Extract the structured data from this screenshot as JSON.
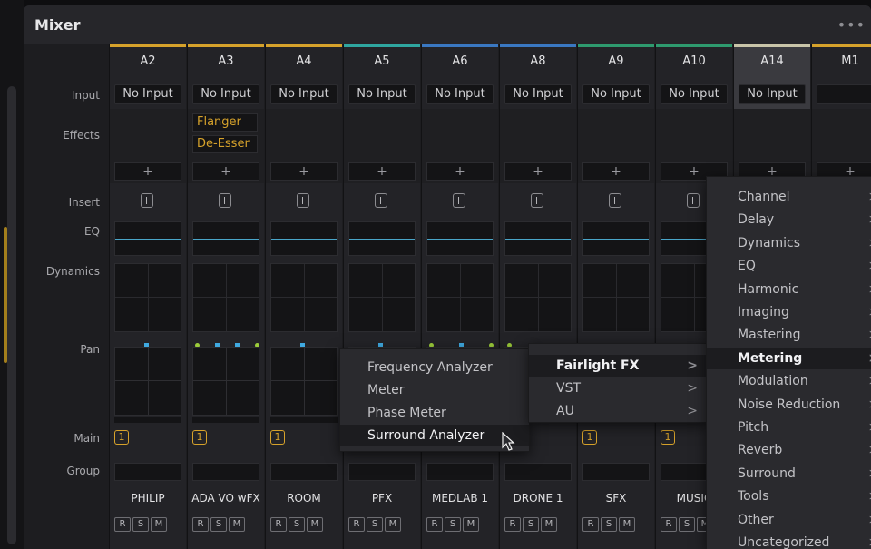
{
  "window": {
    "title": "Mixer",
    "more": "•••"
  },
  "row_labels": [
    "Input",
    "Effects",
    "Insert",
    "EQ",
    "Dynamics",
    "Pan",
    "Main",
    "Group"
  ],
  "strips": [
    {
      "id": "A2",
      "input": "No Input",
      "effects": [],
      "name": "PHILIP",
      "main": "1",
      "color": "#d6a22b",
      "pan_dots": [
        "b"
      ]
    },
    {
      "id": "A3",
      "input": "No Input",
      "effects": [
        "Flanger",
        "De-Esser"
      ],
      "name": "ADA VO wFX",
      "main": "1",
      "color": "#d6a22b",
      "pan_dots": [
        "g",
        "b",
        "b",
        "g"
      ]
    },
    {
      "id": "A4",
      "input": "No Input",
      "effects": [],
      "name": "ROOM",
      "main": "1",
      "color": "#d6a22b",
      "pan_dots": [
        "b"
      ]
    },
    {
      "id": "A5",
      "input": "No Input",
      "effects": [],
      "name": "PFX",
      "main": "",
      "color": "#2fa6a0",
      "pan_dots": [
        "b"
      ]
    },
    {
      "id": "A6",
      "input": "No Input",
      "effects": [],
      "name": "MEDLAB 1",
      "main": "",
      "color": "#3a78c2",
      "pan_dots": [
        "g",
        "b",
        "g"
      ]
    },
    {
      "id": "A8",
      "input": "No Input",
      "effects": [],
      "name": "DRONE 1",
      "main": "",
      "color": "#3a78c2",
      "pan_dots": [
        "g",
        "b",
        "b"
      ]
    },
    {
      "id": "A9",
      "input": "No Input",
      "effects": [],
      "name": "SFX",
      "main": "1",
      "color": "#2e9a6e",
      "pan_dots": []
    },
    {
      "id": "A10",
      "input": "No Input",
      "effects": [],
      "name": "MUSIC",
      "main": "1",
      "color": "#2e9a6e",
      "pan_dots": [
        "b"
      ]
    },
    {
      "id": "A14",
      "input": "No Input",
      "effects": [],
      "name": "",
      "main": "",
      "color": "#c8c4a8",
      "pan_dots": []
    },
    {
      "id": "M1",
      "input": "",
      "effects": [],
      "name": "",
      "main": "",
      "color": "#d6a22b",
      "pan_dots": []
    }
  ],
  "rsm_labels": [
    "R",
    "S",
    "M"
  ],
  "plus_label": "+",
  "menu_plugin_type": {
    "items": [
      {
        "label": "Fairlight FX",
        "arrow": ">"
      },
      {
        "label": "VST",
        "arrow": ">"
      },
      {
        "label": "AU",
        "arrow": ">"
      }
    ]
  },
  "menu_category": {
    "items": [
      "Channel",
      "Delay",
      "Dynamics",
      "EQ",
      "Harmonic",
      "Imaging",
      "Mastering",
      "Metering",
      "Modulation",
      "Noise Reduction",
      "Pitch",
      "Reverb",
      "Surround",
      "Tools",
      "Other",
      "Uncategorized"
    ],
    "arrow": ">",
    "highlighted": "Metering"
  },
  "menu_metering": {
    "items": [
      "Frequency Analyzer",
      "Meter",
      "Phase Meter",
      "Surround Analyzer"
    ],
    "highlighted": "Surround Analyzer"
  }
}
